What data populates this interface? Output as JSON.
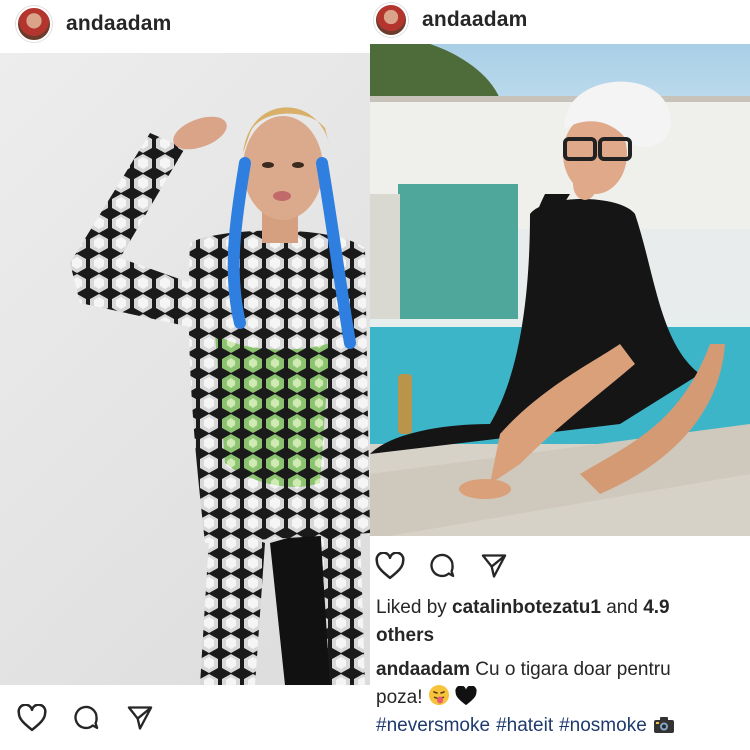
{
  "left_post": {
    "username": "andaadam",
    "actions": {
      "like_icon": "heart-outline-icon",
      "comment_icon": "comment-icon",
      "share_icon": "share-paper-plane-icon"
    }
  },
  "right_post": {
    "username": "andaadam",
    "actions": {
      "like_icon": "heart-outline-icon",
      "comment_icon": "comment-icon",
      "share_icon": "share-paper-plane-icon"
    },
    "likes": {
      "prefix": "Liked by ",
      "user": "catalinbotezatu1",
      "middle": " and ",
      "count": "4.9",
      "suffix": "others"
    },
    "caption": {
      "user": "andaadam",
      "text_line1": " Cu o tigara doar pentru",
      "text_line2": "poza! "
    },
    "hashtags": [
      "#neversmoke",
      "#hateit",
      "#nosmoke"
    ]
  },
  "colors": {
    "text": "#262626",
    "hashtag": "#1e3a6e",
    "background": "#ffffff"
  }
}
